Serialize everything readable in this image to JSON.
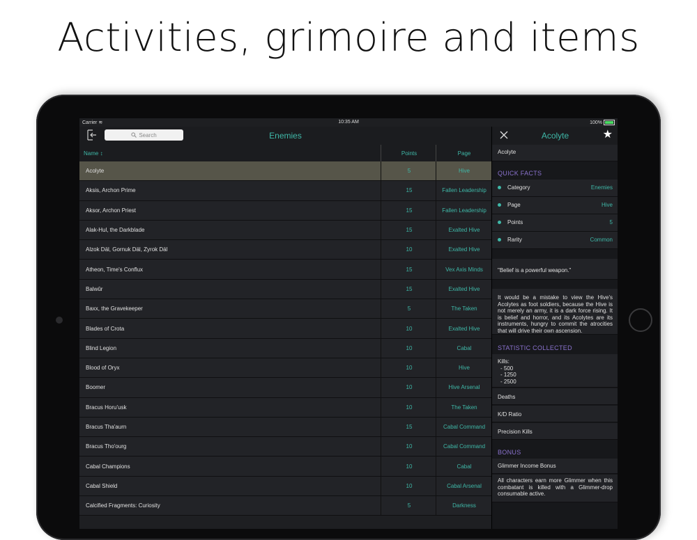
{
  "headline": "Activities, grimoire and items",
  "status": {
    "carrier": "Carrier",
    "time": "10:35 AM",
    "battery": "100%"
  },
  "list": {
    "title": "Enemies",
    "search_placeholder": "Search",
    "columns": {
      "name": "Name",
      "points": "Points",
      "page": "Page"
    },
    "rows": [
      {
        "name": "Acolyte",
        "points": "5",
        "page": "Hive"
      },
      {
        "name": "Aksis, Archon Prime",
        "points": "15",
        "page": "Fallen Leadership"
      },
      {
        "name": "Aksor, Archon Priest",
        "points": "15",
        "page": "Fallen Leadership"
      },
      {
        "name": "Alak-Hul, the Darkblade",
        "points": "15",
        "page": "Exalted Hive"
      },
      {
        "name": "Alzok Däl, Gornuk Däl, Zyrok Däl",
        "points": "10",
        "page": "Exalted Hive"
      },
      {
        "name": "Atheon, Time's Conflux",
        "points": "15",
        "page": "Vex Axis Minds"
      },
      {
        "name": "Balwûr",
        "points": "15",
        "page": "Exalted Hive"
      },
      {
        "name": "Baxx, the Gravekeeper",
        "points": "5",
        "page": "The Taken"
      },
      {
        "name": "Blades of Crota",
        "points": "10",
        "page": "Exalted Hive"
      },
      {
        "name": "Blind Legion",
        "points": "10",
        "page": "Cabal"
      },
      {
        "name": "Blood of Oryx",
        "points": "10",
        "page": "Hive"
      },
      {
        "name": "Boomer",
        "points": "10",
        "page": "Hive Arsenal"
      },
      {
        "name": "Bracus Horu'usk",
        "points": "10",
        "page": "The Taken"
      },
      {
        "name": "Bracus Tha'aurn",
        "points": "15",
        "page": "Cabal Command"
      },
      {
        "name": "Bracus Tho'ourg",
        "points": "10",
        "page": "Cabal Command"
      },
      {
        "name": "Cabal Champions",
        "points": "10",
        "page": "Cabal"
      },
      {
        "name": "Cabal Shield",
        "points": "10",
        "page": "Cabal Arsenal"
      },
      {
        "name": "Calcified Fragments: Curiosity",
        "points": "5",
        "page": "Darkness"
      }
    ]
  },
  "detail": {
    "title": "Acolyte",
    "name": "Acolyte",
    "quick_facts_header": "QUICK FACTS",
    "facts": [
      {
        "key": "Category",
        "value": "Enemies"
      },
      {
        "key": "Page",
        "value": "Hive"
      },
      {
        "key": "Points",
        "value": "5"
      },
      {
        "key": "Rarity",
        "value": "Common"
      }
    ],
    "quote": "\"Belief is a powerful weapon.\"",
    "description": "It would be a mistake to view the Hive's Acolytes as foot soldiers, because the Hive is not merely an army, it is a dark force rising. It is belief and horror, and its Acolytes are its instruments, hungry to commit the atrocities that will drive their own ascension.",
    "statistic_header": "STATISTIC COLLECTED",
    "kills_label": "Kills:",
    "kills": [
      "- 500",
      "- 1250",
      "- 2500"
    ],
    "stats": [
      "Deaths",
      "K/D Ratio",
      "Precision Kills"
    ],
    "bonus_header": "BONUS",
    "bonus_title": "Glimmer Income Bonus",
    "bonus_text": "All characters earn more Glimmer when this combatant is killed with a Glimmer-drop consumable active."
  },
  "colors": {
    "accent": "#3fb8a8",
    "section": "#8a72ce",
    "selected_row": "#565549"
  }
}
